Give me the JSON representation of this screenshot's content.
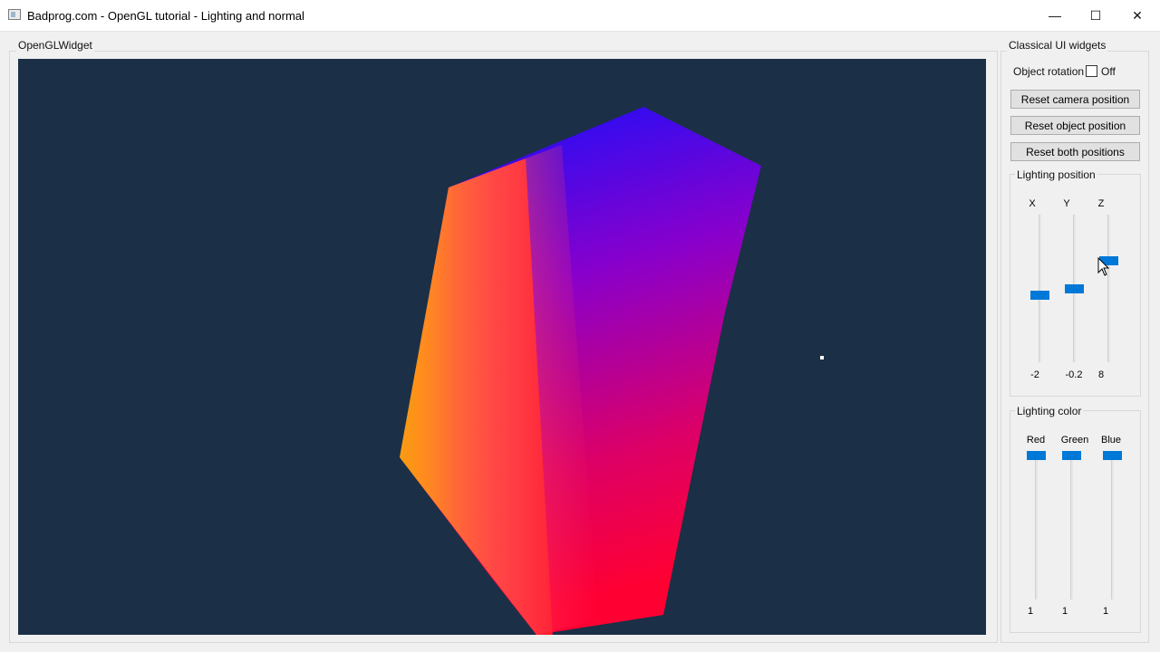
{
  "window": {
    "title": "Badprog.com - OpenGL tutorial - Lighting and normal",
    "minimize_glyph": "—",
    "maximize_glyph": "☐",
    "close_glyph": "✕"
  },
  "gl_widget": {
    "label": "OpenGLWidget",
    "background_color": "#1b2f47"
  },
  "panel": {
    "label": "Classical UI widgets",
    "rotation_label": "Object rotation",
    "rotation_checked": false,
    "rotation_state": "Off",
    "buttons": {
      "reset_camera": "Reset camera position",
      "reset_object": "Reset object position",
      "reset_both": "Reset both positions"
    },
    "lighting_position": {
      "label": "Lighting position",
      "sliders": [
        {
          "axis": "X",
          "value": "-2"
        },
        {
          "axis": "Y",
          "value": "-0.2"
        },
        {
          "axis": "Z",
          "value": "8"
        }
      ]
    },
    "lighting_color": {
      "label": "Lighting color",
      "sliders": [
        {
          "axis": "Red",
          "value": "1"
        },
        {
          "axis": "Green",
          "value": "1"
        },
        {
          "axis": "Blue",
          "value": "1"
        }
      ]
    },
    "accent_color": "#0078d7"
  }
}
